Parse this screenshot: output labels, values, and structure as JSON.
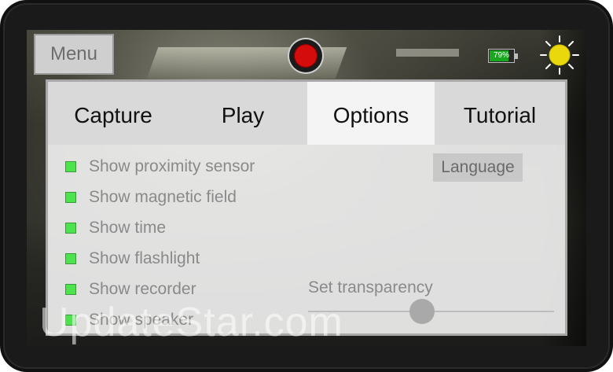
{
  "header": {
    "menu_label": "Menu",
    "battery_text": "79%",
    "battery_level": 0.79
  },
  "tabs": [
    {
      "label": "Capture",
      "active": false
    },
    {
      "label": "Play",
      "active": false
    },
    {
      "label": "Options",
      "active": true
    },
    {
      "label": "Tutorial",
      "active": false
    }
  ],
  "options": [
    {
      "label": "Show proximity sensor"
    },
    {
      "label": "Show magnetic field"
    },
    {
      "label": "Show time"
    },
    {
      "label": "Show flashlight"
    },
    {
      "label": "Show recorder"
    },
    {
      "label": "Show speaker"
    }
  ],
  "language_label": "Language",
  "transparency": {
    "label": "Set transparency",
    "value": 0.45
  },
  "watermark_text": "UpdateStar.com",
  "colors": {
    "checkbox_green": "#4fe24f",
    "record_red": "#d40c0c",
    "battery_green": "#17a81e",
    "sun_yellow": "#e9d80c"
  }
}
